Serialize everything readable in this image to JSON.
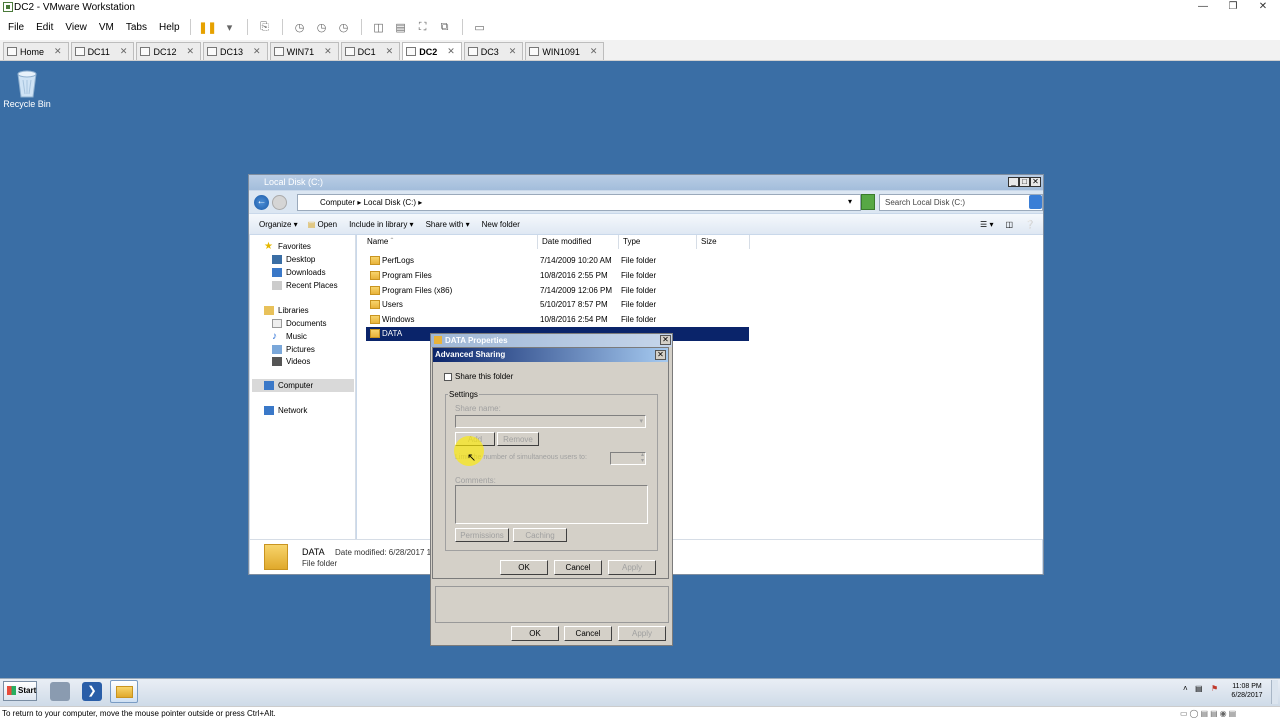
{
  "host": {
    "title": "DC2 - VMware Workstation",
    "menus": [
      "File",
      "Edit",
      "View",
      "VM",
      "Tabs",
      "Help"
    ],
    "tabs": [
      {
        "label": "Home",
        "active": false
      },
      {
        "label": "DC11",
        "active": false
      },
      {
        "label": "DC12",
        "active": false
      },
      {
        "label": "DC13",
        "active": false
      },
      {
        "label": "WIN71",
        "active": false
      },
      {
        "label": "DC1",
        "active": false
      },
      {
        "label": "DC2",
        "active": true
      },
      {
        "label": "DC3",
        "active": false
      },
      {
        "label": "WIN1091",
        "active": false
      }
    ],
    "status_hint": "To return to your computer, move the mouse pointer outside or press Ctrl+Alt."
  },
  "desktop": {
    "background": "#3a6ea5",
    "icons": [
      {
        "label": "Recycle Bin",
        "icon": "recycle-bin-icon"
      }
    ]
  },
  "explorer": {
    "title": "Local Disk (C:)",
    "address": "Computer ▸ Local Disk (C:) ▸",
    "search_placeholder": "Search Local Disk (C:)",
    "commands": [
      "Organize ▾",
      "Open",
      "Include in library ▾",
      "Share with ▾",
      "New folder"
    ],
    "nav": {
      "favorites": "Favorites",
      "fav_items": [
        "Desktop",
        "Downloads",
        "Recent Places"
      ],
      "libraries": "Libraries",
      "lib_items": [
        "Documents",
        "Music",
        "Pictures",
        "Videos"
      ],
      "computer": "Computer",
      "network": "Network"
    },
    "columns": [
      "Name",
      "Date modified",
      "Type",
      "Size"
    ],
    "rows": [
      {
        "name": "PerfLogs",
        "date": "7/14/2009 10:20 AM",
        "type": "File folder"
      },
      {
        "name": "Program Files",
        "date": "10/8/2016 2:55 PM",
        "type": "File folder"
      },
      {
        "name": "Program Files (x86)",
        "date": "7/14/2009 12:06 PM",
        "type": "File folder"
      },
      {
        "name": "Users",
        "date": "5/10/2017 8:57 PM",
        "type": "File folder"
      },
      {
        "name": "Windows",
        "date": "10/8/2016 2:54 PM",
        "type": "File folder"
      },
      {
        "name": "DATA",
        "date": "",
        "type": "",
        "selected": true
      }
    ],
    "details": {
      "name": "DATA",
      "date_label": "Date modified: 6/28/2017 11:",
      "type": "File folder"
    }
  },
  "properties_dialog": {
    "title": "DATA Properties",
    "ok": "OK",
    "cancel": "Cancel",
    "apply": "Apply"
  },
  "advanced_sharing": {
    "title": "Advanced Sharing",
    "share_checkbox": "Share this folder",
    "share_checked": false,
    "settings_group": "Settings",
    "share_name_label": "Share name:",
    "add": "Add",
    "remove": "Remove",
    "limit_label": "Limit the number of simultaneous users to:",
    "comments_label": "Comments:",
    "permissions": "Permissions",
    "caching": "Caching",
    "ok": "OK",
    "cancel": "Cancel",
    "apply": "Apply"
  },
  "taskbar": {
    "start": "Start",
    "clock_time": "11:08 PM",
    "clock_date": "6/28/2017"
  }
}
